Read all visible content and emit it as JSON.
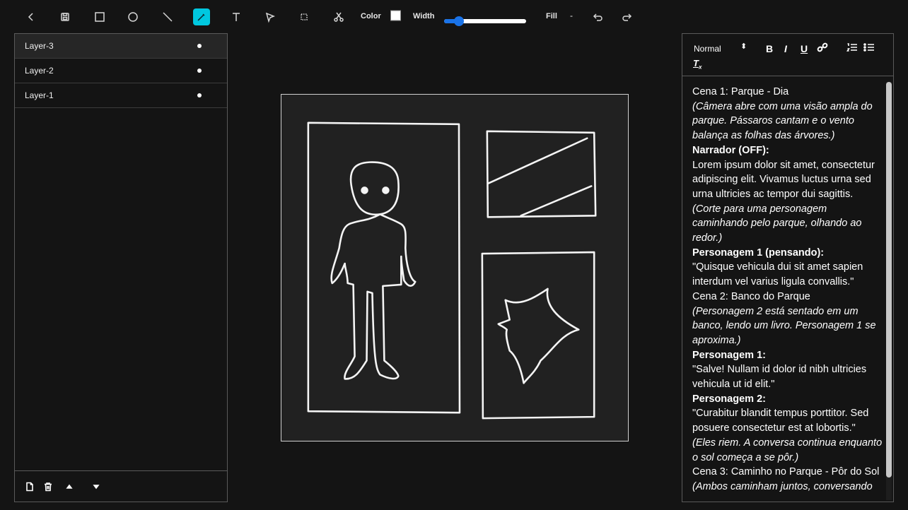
{
  "toolbar": {
    "color_label": "Color",
    "width_label": "Width",
    "fill_label": "Fill",
    "fill_value": "-",
    "stroke_color": "#ffffff",
    "width_level_percent": 18,
    "active_tool": "brush",
    "accent_color": "#00c8e0",
    "tools": [
      "back-icon",
      "save-icon",
      "rectangle-icon",
      "circle-icon",
      "line-icon",
      "brush-icon",
      "text-icon",
      "select-icon",
      "marquee-icon",
      "cut-icon",
      "undo-icon",
      "redo-icon"
    ]
  },
  "layers": {
    "items": [
      {
        "label": "Layer-3",
        "selected": true
      },
      {
        "label": "Layer-2",
        "selected": false
      },
      {
        "label": "Layer-1",
        "selected": false
      }
    ],
    "footer_icons": [
      "new-layer-icon",
      "trash-icon",
      "move-up-icon",
      "move-down-icon"
    ]
  },
  "editor": {
    "format_select": "Normal",
    "format_buttons": [
      "B",
      "I",
      "U"
    ],
    "lines": [
      {
        "text": "Cena 1: Parque - Dia",
        "style": "normal"
      },
      {
        "text": "(Câmera abre com uma visão ampla do parque. Pássaros cantam e o vento balança as folhas das árvores.)",
        "style": "italic"
      },
      {
        "text": "Narrador (OFF):",
        "style": "bold"
      },
      {
        "text": "Lorem ipsum dolor sit amet, consectetur adipiscing elit. Vivamus luctus urna sed urna ultricies ac tempor dui sagittis.",
        "style": "normal"
      },
      {
        "text": "(Corte para uma personagem caminhando pelo parque, olhando ao redor.)",
        "style": "italic"
      },
      {
        "text": "Personagem 1 (pensando):",
        "style": "bold"
      },
      {
        "text": "\"Quisque vehicula dui sit amet sapien interdum vel varius ligula convallis.\"",
        "style": "normal"
      },
      {
        "text": "Cena 2: Banco do Parque",
        "style": "normal"
      },
      {
        "text": "(Personagem 2 está sentado em um banco, lendo um livro. Personagem 1 se aproxima.)",
        "style": "italic"
      },
      {
        "text": "Personagem 1:",
        "style": "bold"
      },
      {
        "text": "\"Salve! Nullam id dolor id nibh ultricies vehicula ut id elit.\"",
        "style": "normal"
      },
      {
        "text": "Personagem 2:",
        "style": "bold"
      },
      {
        "text": "\"Curabitur blandit tempus porttitor. Sed posuere consectetur est at lobortis.\"",
        "style": "normal"
      },
      {
        "text": "(Eles riem. A conversa continua enquanto o sol começa a se pôr.)",
        "style": "italic"
      },
      {
        "text": "Cena 3: Caminho no Parque - Pôr do Sol",
        "style": "normal"
      },
      {
        "text": "(Ambos caminham juntos, conversando",
        "style": "italic"
      }
    ]
  }
}
